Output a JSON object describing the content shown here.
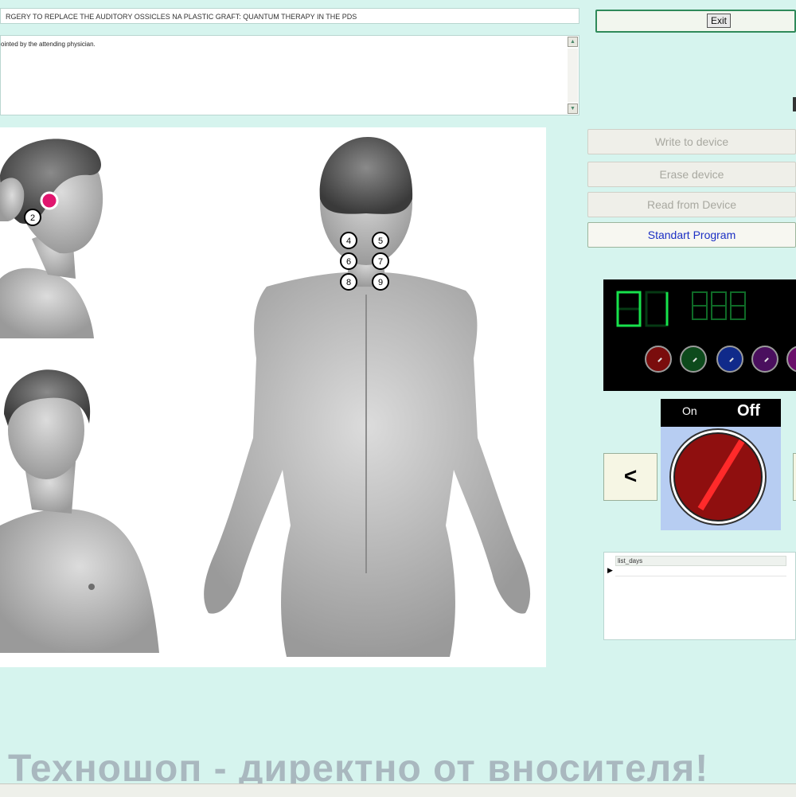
{
  "header": {
    "title_text": "RGERY TO REPLACE THE AUDITORY OSSICLES NA PLASTIC GRAFT: QUANTUM THERAPY IN THE PDS",
    "notes_text": "ointed by the attending physician."
  },
  "exit": {
    "label": "Exit"
  },
  "device": {
    "write_label": "Write to device",
    "erase_label": "Erase device",
    "read_label": "Read from Device",
    "standard_label": "Standart Program"
  },
  "display": {
    "program_number": "01",
    "timer": "888",
    "led_color": "#17e24c",
    "knob_colors": [
      "#7a0d0d",
      "#0d4a1c",
      "#102a8a",
      "#4a0f5e",
      "#6a0e6a"
    ]
  },
  "switch": {
    "on_label": "On",
    "off_label": "Off",
    "state": "Off",
    "knob_color": "#8f0f0f",
    "indicator_color": "#ff2a2a"
  },
  "navigation": {
    "prev_label": "<"
  },
  "list_days": {
    "column_header": "list_days"
  },
  "figure": {
    "points": [
      "2",
      "4",
      "5",
      "6",
      "7",
      "8",
      "9"
    ],
    "highlight_color": "#e0156e"
  },
  "watermark": {
    "text": "Техношоп - директно от вносителя!"
  }
}
